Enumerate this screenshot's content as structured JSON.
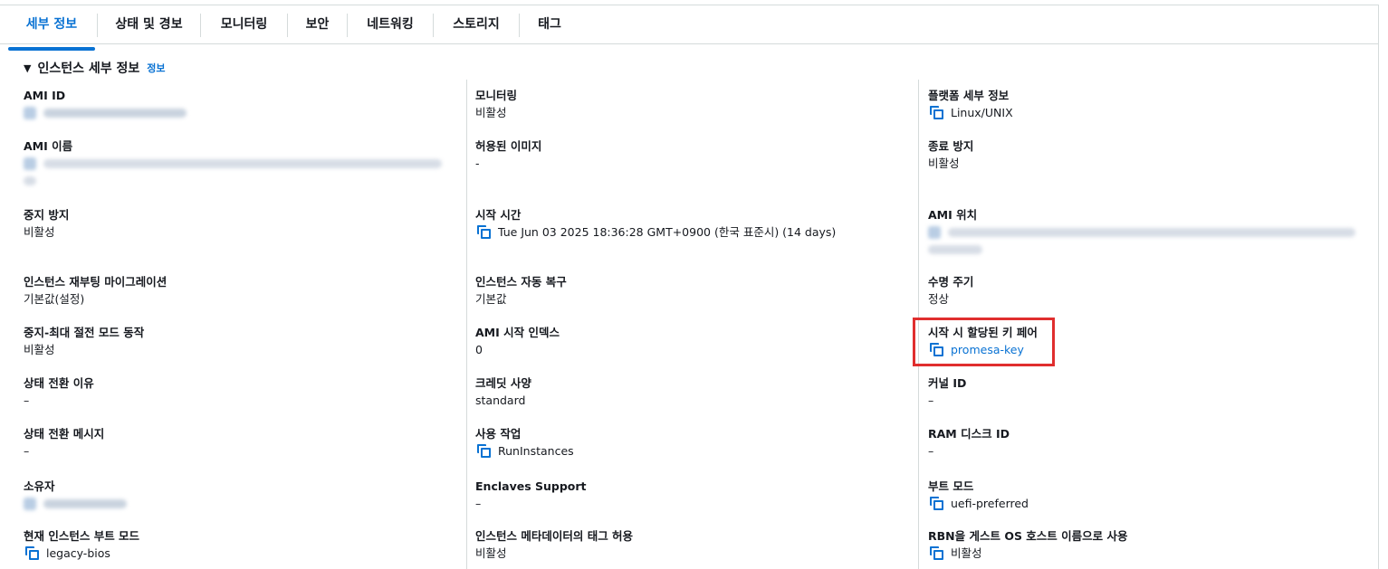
{
  "tabs": [
    {
      "label": "세부 정보",
      "active": true
    },
    {
      "label": "상태 및 경보"
    },
    {
      "label": "모니터링"
    },
    {
      "label": "보안"
    },
    {
      "label": "네트워킹"
    },
    {
      "label": "스토리지"
    },
    {
      "label": "태그"
    }
  ],
  "section": {
    "caret": "▼",
    "title": "인스턴스 세부 정보",
    "info_label": "정보"
  },
  "columns": {
    "left": [
      {
        "label": "AMI ID",
        "value": "",
        "redacted": true
      },
      {
        "label": "AMI 이름",
        "value": "",
        "redacted": true
      },
      {
        "label": "중지 방지",
        "value": "비활성"
      },
      {
        "label": "인스턴스 재부팅 마이그레이션",
        "value": "기본값(설정)"
      },
      {
        "label": "중지-최대 절전 모드 동작",
        "value": "비활성"
      },
      {
        "label": "상태 전환 이유",
        "value": "–"
      },
      {
        "label": "상태 전환 메시지",
        "value": "–"
      },
      {
        "label": "소유자",
        "value": "",
        "redacted": true
      },
      {
        "label": "현재 인스턴스 부트 모드",
        "value": "legacy-bios",
        "copy": true
      }
    ],
    "middle": [
      {
        "label": "모니터링",
        "value": "비활성"
      },
      {
        "label": "허용된 이미지",
        "value": "-"
      },
      {
        "label": "시작 시간",
        "value": "Tue Jun 03 2025 18:36:28 GMT+0900 (한국 표준시) (14 days)",
        "copy": true
      },
      {
        "label": "인스턴스 자동 복구",
        "value": "기본값"
      },
      {
        "label": "AMI 시작 인덱스",
        "value": "0"
      },
      {
        "label": "크레딧 사양",
        "value": "standard"
      },
      {
        "label": "사용 작업",
        "value": "RunInstances",
        "copy": true
      },
      {
        "label": "Enclaves Support",
        "value": "–"
      },
      {
        "label": "인스턴스 메타데이터의 태그 허용",
        "value": "비활성"
      }
    ],
    "right": [
      {
        "label": "플랫폼 세부 정보",
        "value": "Linux/UNIX",
        "copy": true
      },
      {
        "label": "종료 방지",
        "value": "비활성"
      },
      {
        "label": "AMI 위치",
        "value": "",
        "redacted": true
      },
      {
        "label": "수명 주기",
        "value": "정상"
      },
      {
        "label": "시작 시 할당된 키 페어",
        "value": "promesa-key",
        "copy": true,
        "link": true
      },
      {
        "label": "커널 ID",
        "value": "–"
      },
      {
        "label": "RAM 디스크 ID",
        "value": "–"
      },
      {
        "label": "부트 모드",
        "value": "uefi-preferred",
        "copy": true
      },
      {
        "label": "RBN을 게스트 OS 호스트 이름으로 사용",
        "value": "비활성",
        "copy": true
      }
    ]
  },
  "colors": {
    "accent": "#0972d3",
    "text": "#16191f",
    "border": "#d5dbdb",
    "highlight": "#e02e2e"
  },
  "icons": {
    "copy": "copy-icon",
    "caret": "caret-down-icon"
  }
}
